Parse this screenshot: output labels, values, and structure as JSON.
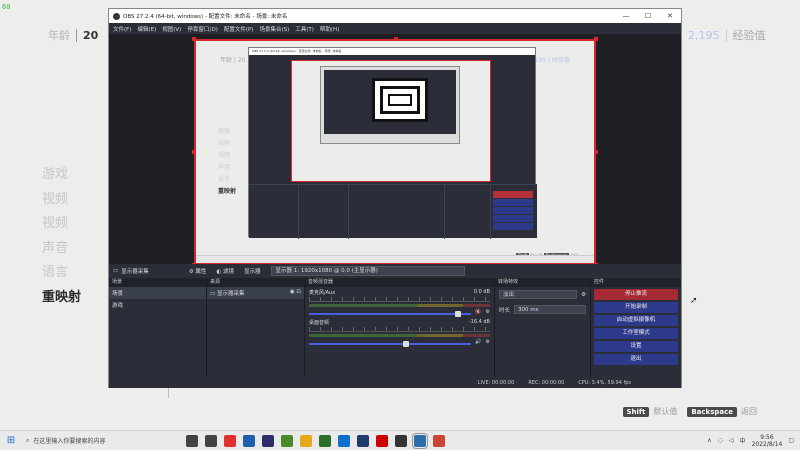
{
  "hud": {
    "fps": "60",
    "age_label": "年龄",
    "age_value": "20",
    "exp_value": "2,195",
    "exp_label": "经验值"
  },
  "side_menu": [
    "游戏",
    "视频",
    "视频",
    "声音",
    "语言",
    "重映射"
  ],
  "hints": {
    "shift_key": "Shift",
    "shift_label": "默认值",
    "backspace_key": "Backspace",
    "backspace_label": "返回"
  },
  "obs": {
    "title": "OBS 27.2.4 (64-bit, windows) - 配置文件: 未命名 - 场景: 未命名",
    "menu": [
      "文件(F)",
      "编辑(E)",
      "视图(V)",
      "停靠窗口(D)",
      "配置文件(P)",
      "场景集合(S)",
      "工具(T)",
      "帮助(H)"
    ],
    "source_toolbar": {
      "source_name": "显示器采集",
      "properties": "属性",
      "filters": "滤镜",
      "display_label": "显示器",
      "display_value": "显示器 1: 1920x1080 @ 0,0 (主显示器)"
    },
    "scenes": {
      "header": "场景",
      "items": [
        "场景",
        "游戏"
      ]
    },
    "sources": {
      "header": "来源",
      "items": [
        "显示器采集"
      ]
    },
    "mixer": {
      "header": "音频混音器",
      "channels": [
        {
          "name": "麦克风/Aux",
          "db": "0.0 dB",
          "level": 0.92
        },
        {
          "name": "桌面音频",
          "db": "-16.4 dB",
          "level": 0.6
        }
      ]
    },
    "transitions": {
      "header": "转场特效",
      "type": "淡出",
      "duration_label": "时长",
      "duration_value": "300 ms"
    },
    "controls": {
      "header": "控件",
      "buttons": [
        "停止推流",
        "开始录制",
        "启动虚拟摄像机",
        "工作室模式",
        "设置",
        "退出"
      ]
    },
    "status": {
      "live": "LIVE: 00:00:00",
      "rec": "REC: 00:00:00",
      "cpu": "CPU: 3.4%, 59.94 fps"
    }
  },
  "nested": {
    "age": "年龄 | 20",
    "exp": "2,195 | 经验值",
    "menu": [
      "游戏",
      "视频",
      "视频",
      "声音",
      "语言",
      "重映射"
    ],
    "shift": "Shift",
    "shift_label": "默认值",
    "backspace": "Backspace",
    "backspace_label": "返回"
  },
  "taskbar": {
    "search_placeholder": "在这里输入你要搜索的内容",
    "time": "9:56",
    "date": "2022/8/14",
    "icon_colors": [
      "#444",
      "#444",
      "#e03131",
      "#1f5fae",
      "#2d2d6e",
      "#4a8a2a",
      "#e6a817",
      "#2b6e2b",
      "#0f6fcf",
      "#1f3c6e",
      "#c00",
      "#333",
      "#2b6ea8",
      "#c43"
    ]
  }
}
